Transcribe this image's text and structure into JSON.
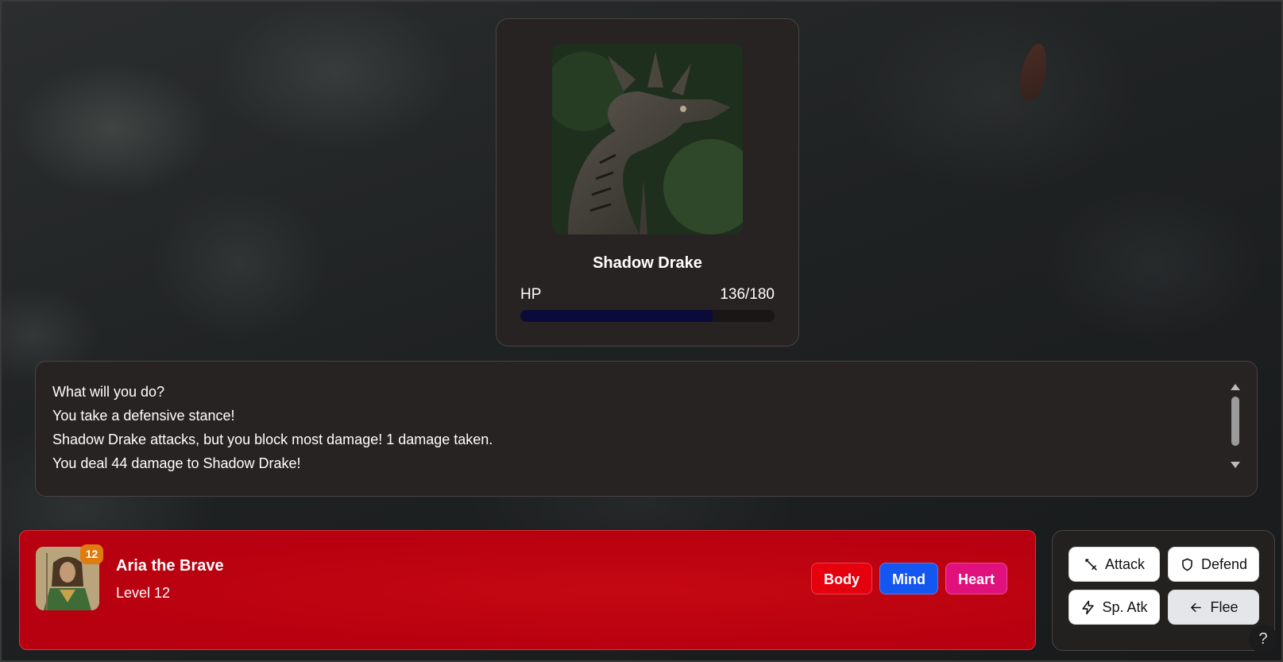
{
  "enemy": {
    "name": "Shadow Drake",
    "hp_label": "HP",
    "hp_text": "136/180",
    "hp_current": 136,
    "hp_max": 180,
    "portrait_icon": "dragon-statue-image"
  },
  "log": {
    "lines": [
      "What will you do?",
      "You take a defensive stance!",
      "Shadow Drake attacks, but you block most damage! 1 damage taken.",
      "You deal 44 damage to Shadow Drake!"
    ]
  },
  "player": {
    "name": "Aria the Brave",
    "level_text": "Level 12",
    "level_badge": "12",
    "stats": [
      "Body",
      "Mind",
      "Heart"
    ],
    "panel_color": "#c50812"
  },
  "actions": {
    "attack": "Attack",
    "defend": "Defend",
    "sp_atk": "Sp. Atk",
    "flee": "Flee"
  },
  "help": "?",
  "colors": {
    "body": "#e5000e",
    "mind": "#1456f0",
    "heart": "#e0117c",
    "badge": "#e07b0e",
    "hp_fill": "#0b0b3a"
  }
}
